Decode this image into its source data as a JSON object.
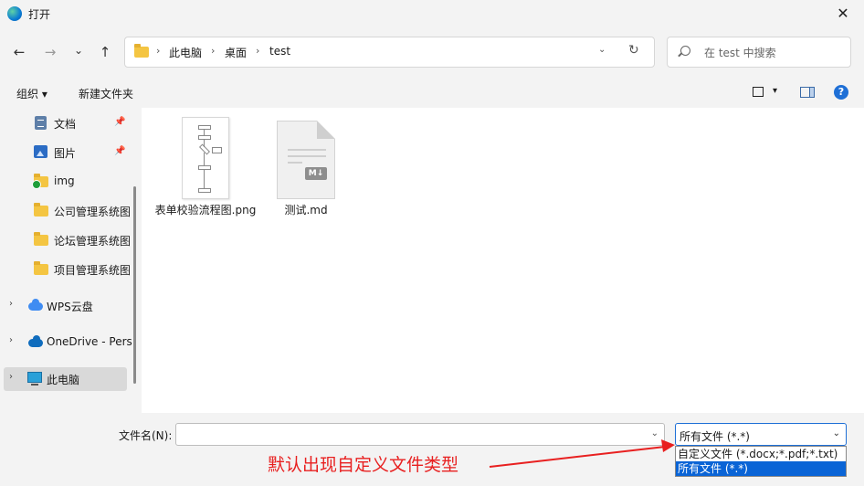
{
  "window": {
    "title": "打开",
    "close_glyph": "✕"
  },
  "nav": {
    "back_glyph": "←",
    "forward_glyph": "→",
    "recent_glyph": "⌄",
    "up_glyph": "↑",
    "breadcrumbs": [
      "此电脑",
      "桌面",
      "test"
    ],
    "separator": "›",
    "dropdown_glyph": "⌄",
    "refresh_glyph": "↻"
  },
  "search": {
    "placeholder": "在 test 中搜索"
  },
  "toolbar": {
    "organize_label": "组织 ▾",
    "new_folder_label": "新建文件夹",
    "view_dropdown": "▾",
    "help_label": "?"
  },
  "sidebar": {
    "items": [
      {
        "label": "文档",
        "icon": "document-icon",
        "pinned": true
      },
      {
        "label": "图片",
        "icon": "pictures-icon",
        "pinned": true
      },
      {
        "label": "img",
        "icon": "folder-icon"
      },
      {
        "label": "公司管理系统图",
        "icon": "folder-icon"
      },
      {
        "label": "论坛管理系统图",
        "icon": "folder-icon"
      },
      {
        "label": "项目管理系统图",
        "icon": "folder-icon"
      },
      {
        "label": "WPS云盘",
        "icon": "wps-cloud-icon",
        "expandable": true
      },
      {
        "label": "OneDrive - Pers",
        "icon": "onedrive-icon",
        "expandable": true
      },
      {
        "label": "此电脑",
        "icon": "computer-icon",
        "expandable": true,
        "selected": true
      }
    ],
    "pin_glyph": "📌",
    "chevron_glyph": "›"
  },
  "files": [
    {
      "name": "表单校验流程图.png",
      "type": "image"
    },
    {
      "name": "测试.md",
      "type": "markdown",
      "badge": "M↓"
    }
  ],
  "footer": {
    "filename_label": "文件名(N):",
    "filename_value": "",
    "filetype_selected": "所有文件 (*.*)",
    "filetype_options": [
      {
        "label": "自定义文件 (*.docx;*.pdf;*.txt)",
        "highlighted": false
      },
      {
        "label": "所有文件 (*.*)",
        "highlighted": true
      }
    ]
  },
  "annotation": {
    "text": "默认出现自定义文件类型",
    "color": "#e82020"
  },
  "colors": {
    "accent": "#0a64d6",
    "folder": "#f4c542",
    "background": "#f3f3f3"
  }
}
